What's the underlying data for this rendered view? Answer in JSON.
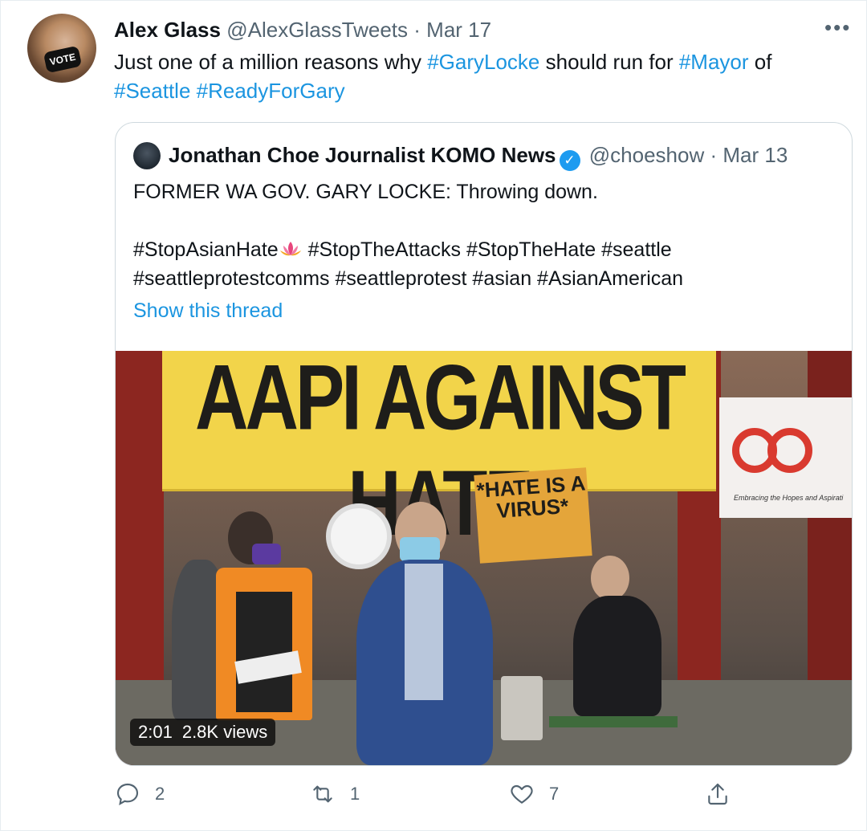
{
  "tweet": {
    "author_name": "Alex Glass",
    "author_handle": "@AlexGlassTweets",
    "separator": "·",
    "date": "Mar 17",
    "more": "•••",
    "text_parts": [
      {
        "text": "Just one of a million reasons why ",
        "type": "plain"
      },
      {
        "text": "#GaryLocke",
        "type": "hashtag"
      },
      {
        "text": " should run for ",
        "type": "plain"
      },
      {
        "text": "#Mayor",
        "type": "hashtag"
      },
      {
        "text": " of ",
        "type": "plain"
      },
      {
        "text": "#Seattle",
        "type": "hashtag"
      },
      {
        "text": " ",
        "type": "plain"
      },
      {
        "text": "#ReadyForGary",
        "type": "hashtag"
      }
    ],
    "avatar_mask_text": "VOTE"
  },
  "quote": {
    "author_name": "Jonathan Choe Journalist KOMO News",
    "author_handle": "@choeshow",
    "separator": "·",
    "date": "Mar 13",
    "line1": "FORMER WA GOV. GARY LOCKE: Throwing down.",
    "tags_line1_a": "#StopAsianHate",
    "tags_line1_b": " #StopTheAttacks #StopTheHate #seattle",
    "tags_line2": "#seattleprotestcomms #seattleprotest #asian #AsianAmerican",
    "show_thread": "Show this thread",
    "media": {
      "banner_text": "AAPI AGAINST HATE",
      "sign_text": "*HATE IS A VIRUS*",
      "org_caption": "Embracing the Hopes and Aspirati",
      "duration": "2:01",
      "views": "2.8K views"
    }
  },
  "actions": {
    "reply_count": "2",
    "retweet_count": "1",
    "like_count": "7"
  },
  "colors": {
    "link": "#1b95e0",
    "muted": "#536471",
    "verified": "#1d9bf0"
  }
}
